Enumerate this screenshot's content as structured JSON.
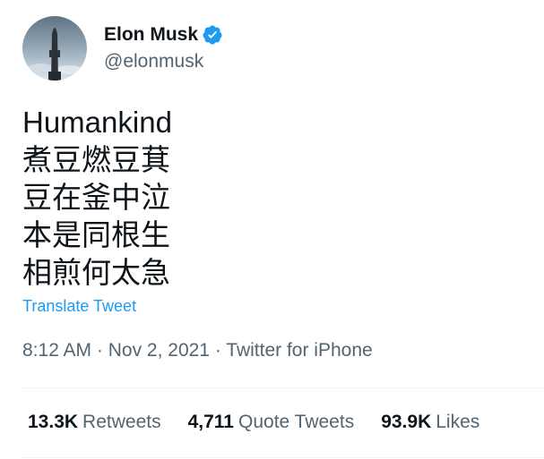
{
  "author": {
    "name": "Elon Musk",
    "handle": "@elonmusk",
    "verified": true,
    "verified_color": "#1d9bf0"
  },
  "tweet": {
    "lines": [
      "Humankind",
      "煮豆燃豆萁",
      "豆在釜中泣",
      "本是同根生",
      "相煎何太急"
    ],
    "translate_label": "Translate Tweet",
    "time": "8:12 AM",
    "date": "Nov 2, 2021",
    "source": "Twitter for iPhone"
  },
  "stats": {
    "retweets": {
      "count": "13.3K",
      "label": "Retweets"
    },
    "quote_tweets": {
      "count": "4,711",
      "label": "Quote Tweets"
    },
    "likes": {
      "count": "93.9K",
      "label": "Likes"
    }
  },
  "colors": {
    "accent": "#1d9bf0",
    "text": "#0f1419",
    "secondary": "#536471"
  }
}
